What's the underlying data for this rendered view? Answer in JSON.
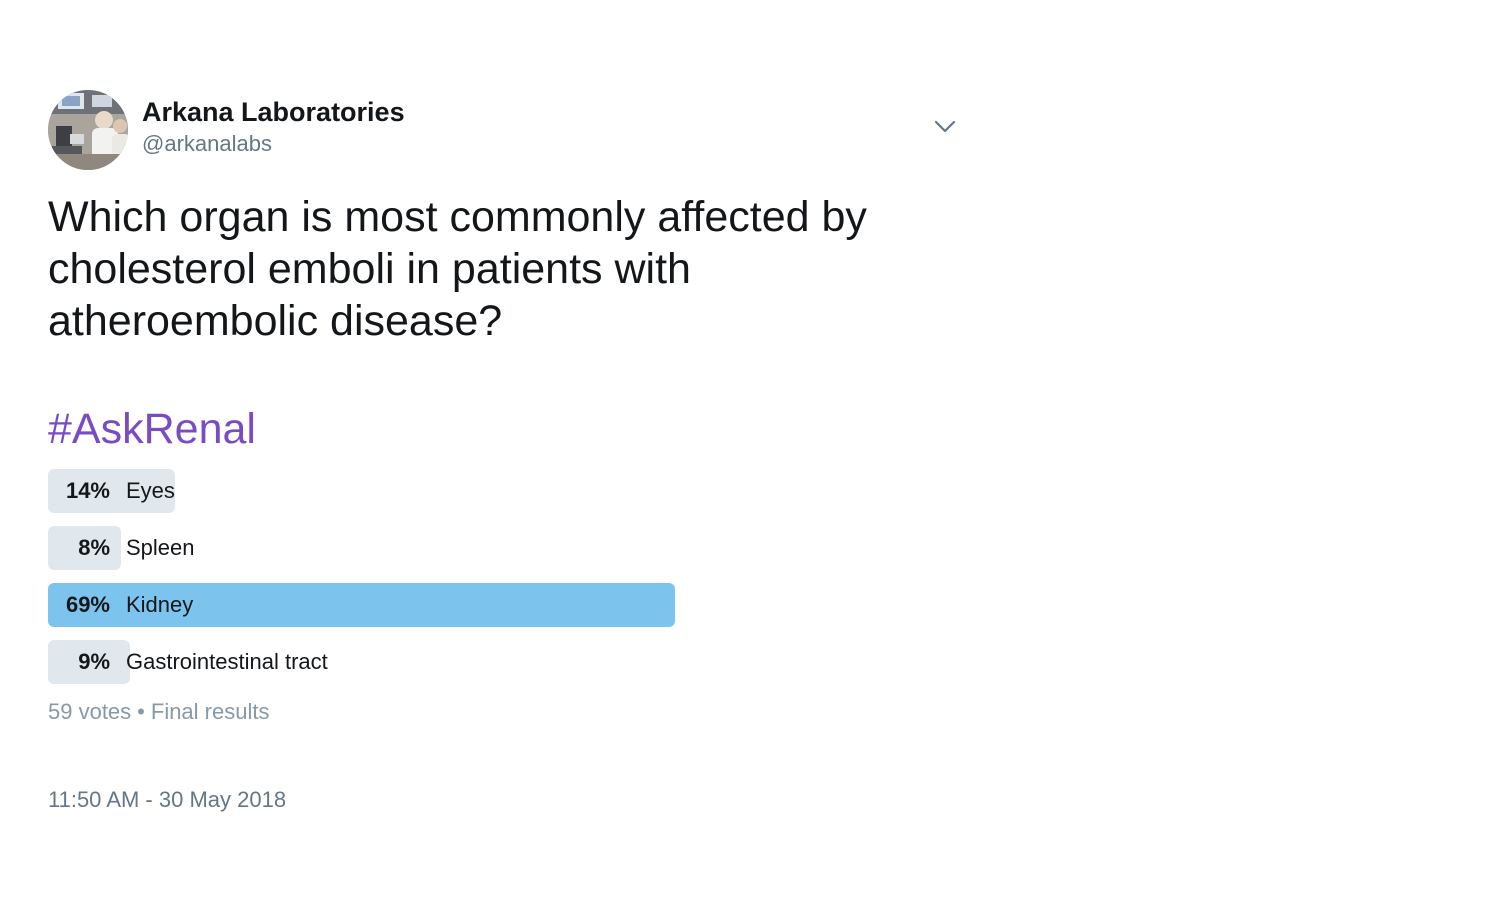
{
  "author": {
    "display_name": "Arkana Laboratories",
    "handle": "@arkanalabs"
  },
  "tweet": {
    "text": "Which organ is most commonly affected by cholesterol emboli in patients with atheroembolic disease?",
    "hashtag": "#AskRenal",
    "hashtag_color": "#794bc4",
    "timestamp": "11:50 AM - 30 May 2018"
  },
  "poll": {
    "choices": [
      {
        "percent_label": "14%",
        "label": "Eyes",
        "fraction": 0.14,
        "winner": false
      },
      {
        "percent_label": "8%",
        "label": "Spleen",
        "fraction": 0.08,
        "winner": false
      },
      {
        "percent_label": "69%",
        "label": "Kidney",
        "fraction": 0.69,
        "winner": true
      },
      {
        "percent_label": "9%",
        "label": "Gastrointestinal tract",
        "fraction": 0.09,
        "winner": false
      }
    ],
    "votes": "59 votes",
    "separator": "•",
    "status": "Final results",
    "winner_color": "#7cc4ee",
    "bar_color": "#e1e8ed"
  },
  "icons": {
    "caret": "chevron-down-icon",
    "avatar": "profile-photo"
  }
}
